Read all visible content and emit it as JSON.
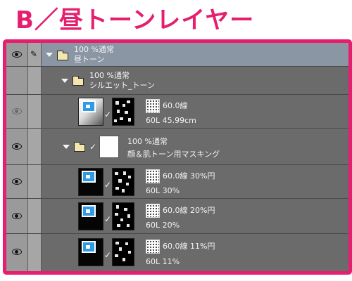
{
  "title": "B／昼トーンレイヤー",
  "colors": {
    "frame": "#e61e6e",
    "title": "#e61e6e",
    "selected_row": "#8a96a4",
    "panel": "#6b6b6b"
  },
  "layers": [
    {
      "id": "folder1",
      "type": "folder",
      "line1": "100 %通常",
      "line2": "昼トーン",
      "selected": true,
      "eye_visible": true
    },
    {
      "id": "folder2",
      "type": "folder",
      "line1": "100 %通常",
      "line2": "シルエット_トーン",
      "selected": false,
      "eye_visible": false
    },
    {
      "id": "tone1",
      "type": "tone",
      "line1": "60.0線",
      "line2": "60L 45.99cm",
      "eye_visible": "dim"
    },
    {
      "id": "folder3",
      "type": "folder",
      "line1": "100 %通常",
      "line2": "顔＆肌トーン用マスキング",
      "eye_visible": true
    },
    {
      "id": "tone2",
      "type": "tone",
      "line1": "60.0線 30%円",
      "line2": "60L 30%",
      "eye_visible": true
    },
    {
      "id": "tone3",
      "type": "tone",
      "line1": "60.0線 20%円",
      "line2": "60L 20%",
      "eye_visible": true
    },
    {
      "id": "tone4",
      "type": "tone",
      "line1": "60.0線 11%円",
      "line2": "60L 11%",
      "eye_visible": true
    }
  ],
  "icons": {
    "eye": "eye-icon",
    "pencil": "pencil-icon",
    "expand": "expand-triangle-icon",
    "folder": "folder-icon",
    "check": "checkmark-icon",
    "tone_pattern": "tone-pattern-icon"
  }
}
